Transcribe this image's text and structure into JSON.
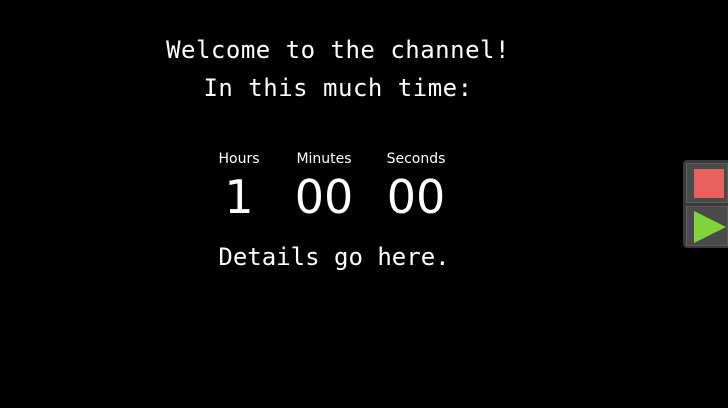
{
  "heading": {
    "line1": "Welcome to the channel!",
    "line2": "In this much time:"
  },
  "countdown": {
    "hours_label": "Hours",
    "hours_value": "1",
    "minutes_label": "Minutes",
    "minutes_value": "00",
    "seconds_label": "Seconds",
    "seconds_value": "00"
  },
  "details": "Details go here.",
  "controls": {
    "stop_icon": "stop-icon",
    "stop_color": "#e8615d",
    "play_icon": "play-icon",
    "play_color": "#7fd43b"
  },
  "colors": {
    "background": "#000000",
    "text": "#ffffff"
  }
}
